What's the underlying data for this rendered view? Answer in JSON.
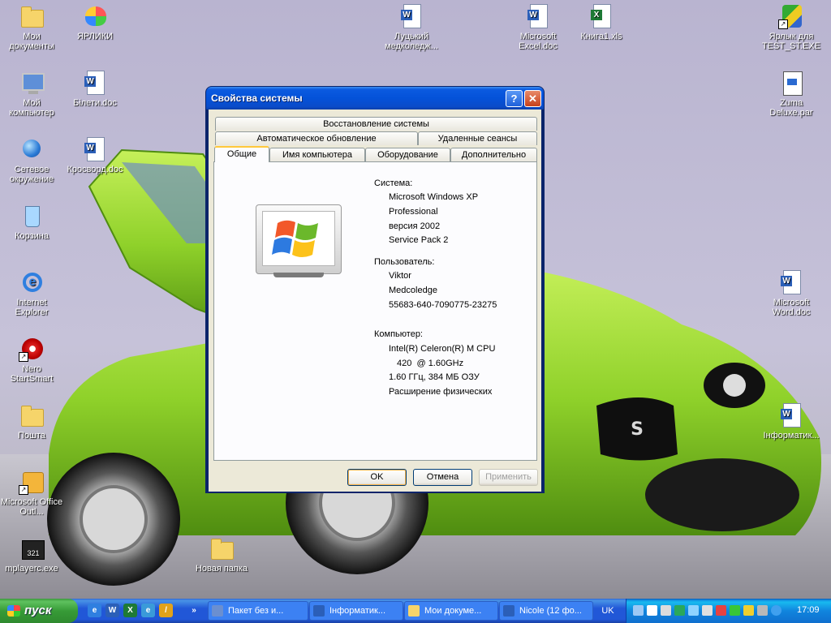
{
  "desktop": {
    "icons_left": [
      {
        "label": "Мои документы",
        "icon": "my-documents-icon"
      },
      {
        "label": "ЯРЛИКИ",
        "icon": "butterfly-icon"
      },
      {
        "label": "Мой компьютер",
        "icon": "my-computer-icon"
      },
      {
        "label": "Білети.doc",
        "icon": "word-doc-icon"
      },
      {
        "label": "Сетевое окружение",
        "icon": "network-icon"
      },
      {
        "label": "Кросворд.doc",
        "icon": "word-doc-icon"
      },
      {
        "label": "Корзина",
        "icon": "recycle-bin-icon"
      },
      {
        "label": "Internet Explorer",
        "icon": "internet-explorer-icon"
      },
      {
        "label": "Nero StartSmart",
        "icon": "nero-icon"
      },
      {
        "label": "Пошта",
        "icon": "folder-icon"
      },
      {
        "label": "Microsoft Office Outl...",
        "icon": "outlook-icon"
      },
      {
        "label": "mplayerc.exe",
        "icon": "media-player-icon"
      },
      {
        "label": "Новая папка",
        "icon": "folder-icon"
      }
    ],
    "icons_top": [
      {
        "label": "Луцький медколедж...",
        "icon": "word-doc-icon"
      },
      {
        "label": "Microsoft Excel.doc",
        "icon": "word-doc-icon"
      },
      {
        "label": "Книга1.xls",
        "icon": "excel-doc-icon"
      }
    ],
    "icons_right": [
      {
        "label": "Ярлык для TEST_ST.EXE",
        "icon": "test-exe-icon"
      },
      {
        "label": "Zuma Deluxe.par",
        "icon": "zuma-icon"
      },
      {
        "label": "Microsoft Word.doc",
        "icon": "word-doc-icon"
      },
      {
        "label": "Інформатик...",
        "icon": "word-doc-icon"
      }
    ]
  },
  "dialog": {
    "title": "Свойства системы",
    "help_label": "?",
    "close_label": "✕",
    "tabs_row1": [
      "Восстановление системы"
    ],
    "tabs_row2": [
      "Автоматическое обновление",
      "Удаленные сеансы"
    ],
    "tabs_row3": [
      "Общие",
      "Имя компьютера",
      "Оборудование",
      "Дополнительно"
    ],
    "active_tab": "Общие",
    "system_label": "Система:",
    "system_lines": [
      "Microsoft Windows XP",
      "Professional",
      "версия 2002",
      "Service Pack 2"
    ],
    "user_label": "Пользователь:",
    "user_lines": [
      "Viktor",
      "Medcoledge",
      "55683-640-7090775-23275"
    ],
    "computer_label": "Компьютер:",
    "computer_lines": [
      "Intel(R) Celeron(R) M CPU",
      "420  @ 1.60GHz",
      "1.60 ГГц, 384 МБ ОЗУ",
      "Расширение физических"
    ],
    "buttons": {
      "ok": "OK",
      "cancel": "Отмена",
      "apply": "Применить"
    }
  },
  "taskbar": {
    "start_label": "пуск",
    "overflow": "»",
    "apps": [
      {
        "label": "Пакет без и...",
        "color": "#6b8fd0"
      },
      {
        "label": "Інформатик...",
        "color": "#2b5fb8"
      },
      {
        "label": "Мои докуме...",
        "color": "#f6d46a"
      },
      {
        "label": "Nicole (12 фо...",
        "color": "#2b5fb8"
      }
    ],
    "language": "UK",
    "clock": "17:09"
  },
  "colors": {
    "car": "#8fd12a",
    "accent_blue": "#0a4bc9",
    "start_green": "#379b37"
  }
}
